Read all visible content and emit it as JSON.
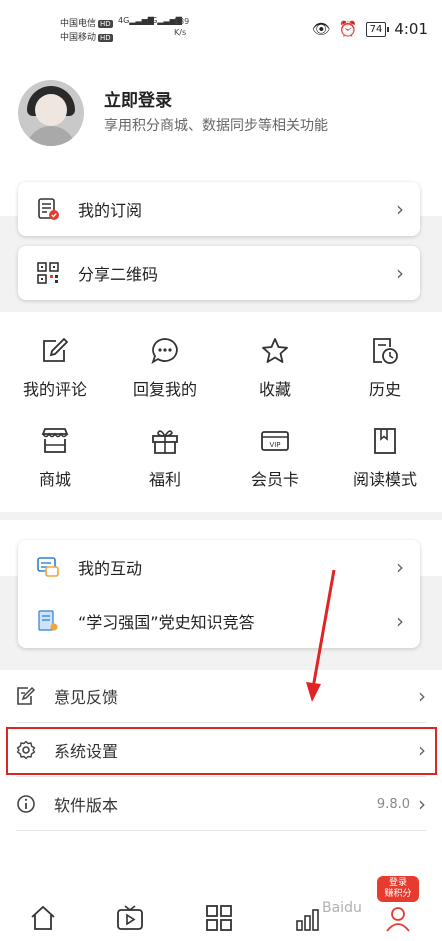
{
  "status_bar": {
    "carrier1": "中国电信",
    "carrier2": "中国移动",
    "hd_badge": "HD",
    "net1": "4G",
    "net2": "4G",
    "speed_value": "139",
    "speed_unit": "K/s",
    "battery": "74",
    "time": "4:01"
  },
  "profile": {
    "title": "立即登录",
    "subtitle": "享用积分商城、数据同步等相关功能"
  },
  "cards_top": [
    {
      "label": "我的订阅",
      "icon": "subscription-icon"
    },
    {
      "label": "分享二维码",
      "icon": "qr-code-icon"
    }
  ],
  "grid": [
    {
      "label": "我的评论",
      "icon": "edit-comment-icon"
    },
    {
      "label": "回复我的",
      "icon": "chat-bubble-icon"
    },
    {
      "label": "收藏",
      "icon": "star-icon"
    },
    {
      "label": "历史",
      "icon": "history-icon"
    },
    {
      "label": "商城",
      "icon": "store-icon"
    },
    {
      "label": "福利",
      "icon": "gift-icon"
    },
    {
      "label": "会员卡",
      "icon": "vip-card-icon"
    },
    {
      "label": "阅读模式",
      "icon": "bookmark-icon"
    }
  ],
  "cards_middle": [
    {
      "label": "我的互动",
      "icon": "interaction-icon"
    },
    {
      "label": "“学习强国”党史知识竞答",
      "icon": "quiz-icon"
    }
  ],
  "settings_list": [
    {
      "label": "意见反馈",
      "icon": "feedback-icon",
      "value": ""
    },
    {
      "label": "系统设置",
      "icon": "gear-icon",
      "value": ""
    },
    {
      "label": "软件版本",
      "icon": "info-icon",
      "value": "9.8.0"
    }
  ],
  "promo_badge": {
    "line1": "登录",
    "line2": "赚积分"
  },
  "watermark": "Baidu",
  "colors": {
    "accent": "#e63b2e",
    "highlight_box": "#e02424",
    "band": "#f2f2f2"
  }
}
